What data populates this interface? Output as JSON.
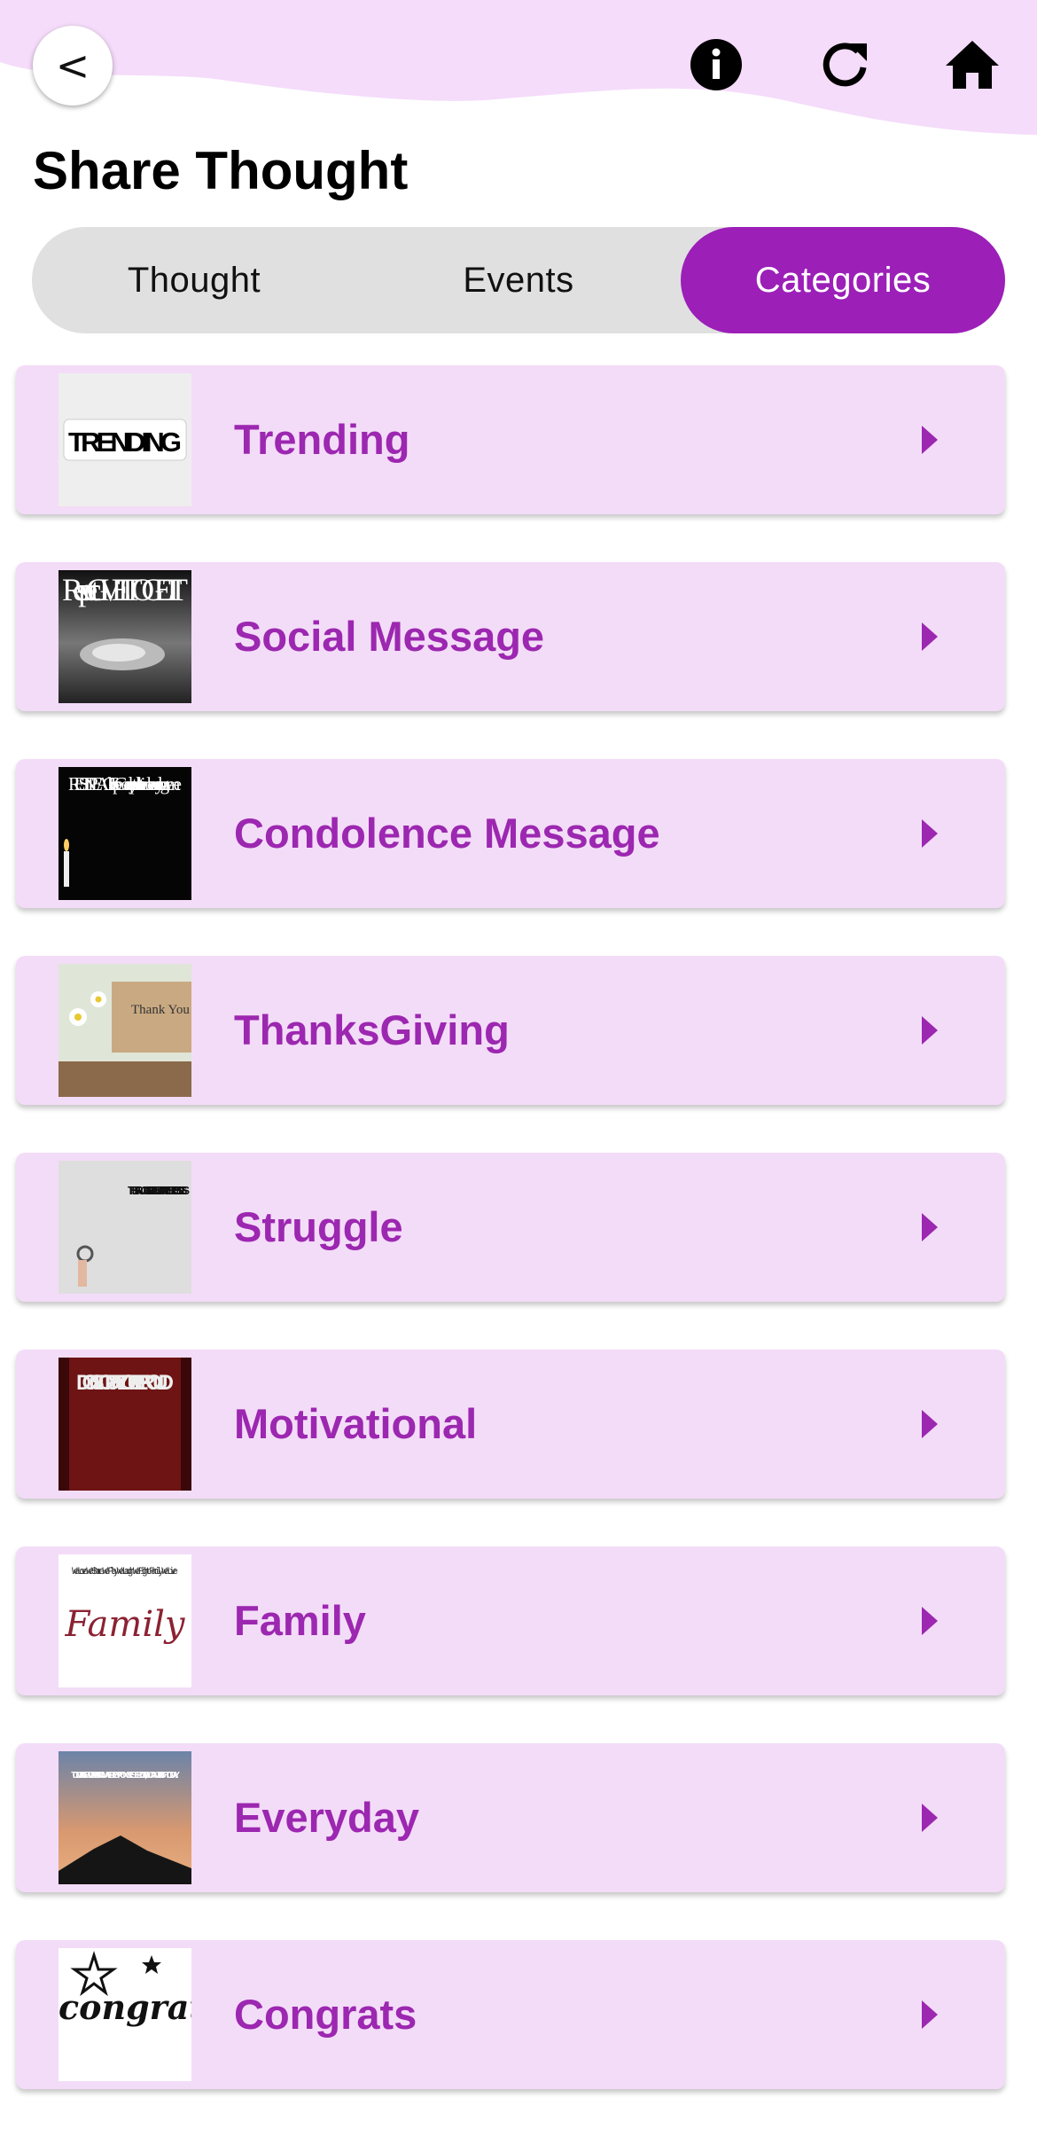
{
  "header": {
    "title": "Share Thought",
    "back_label": "<",
    "icons": [
      "info-icon",
      "refresh-icon",
      "home-icon"
    ]
  },
  "tabs": [
    {
      "label": "Thought",
      "active": false
    },
    {
      "label": "Events",
      "active": false
    },
    {
      "label": "Categories",
      "active": true
    }
  ],
  "categories": [
    {
      "label": "Trending",
      "thumb_text": "TRENDING"
    },
    {
      "label": "Social Message",
      "thumb_text": "Respect GIVE IT TO GET IT"
    },
    {
      "label": "Condolence Message",
      "thumb_text": "REST IN PEACE I hope God accepts you with the same love and care you gave me"
    },
    {
      "label": "ThanksGiving",
      "thumb_text": "Thank You"
    },
    {
      "label": "Struggle",
      "thumb_text": "THE STRUGGLE IS REAL BUT SO ARE THE BLESSINGS"
    },
    {
      "label": "Motivational",
      "thumb_text": "DON'T STOP UNTIL YOU'RE PROUD"
    },
    {
      "label": "Family",
      "thumb_text": "We Love We Share We Play We Laugh We Fight Family We Live"
    },
    {
      "label": "Everyday",
      "thumb_text": "TODAY IS A NEW DAY. EVEN IF YOU WERE WRONG YESTERDAY, YOU CAN GET IT RIGHT TODAY."
    },
    {
      "label": "Congrats",
      "thumb_text": "congratulations"
    }
  ],
  "colors": {
    "accent": "#9c1fb8",
    "card_bg": "#f3dcf8",
    "wave": "#f5dcfa",
    "label": "#9c27b0"
  }
}
